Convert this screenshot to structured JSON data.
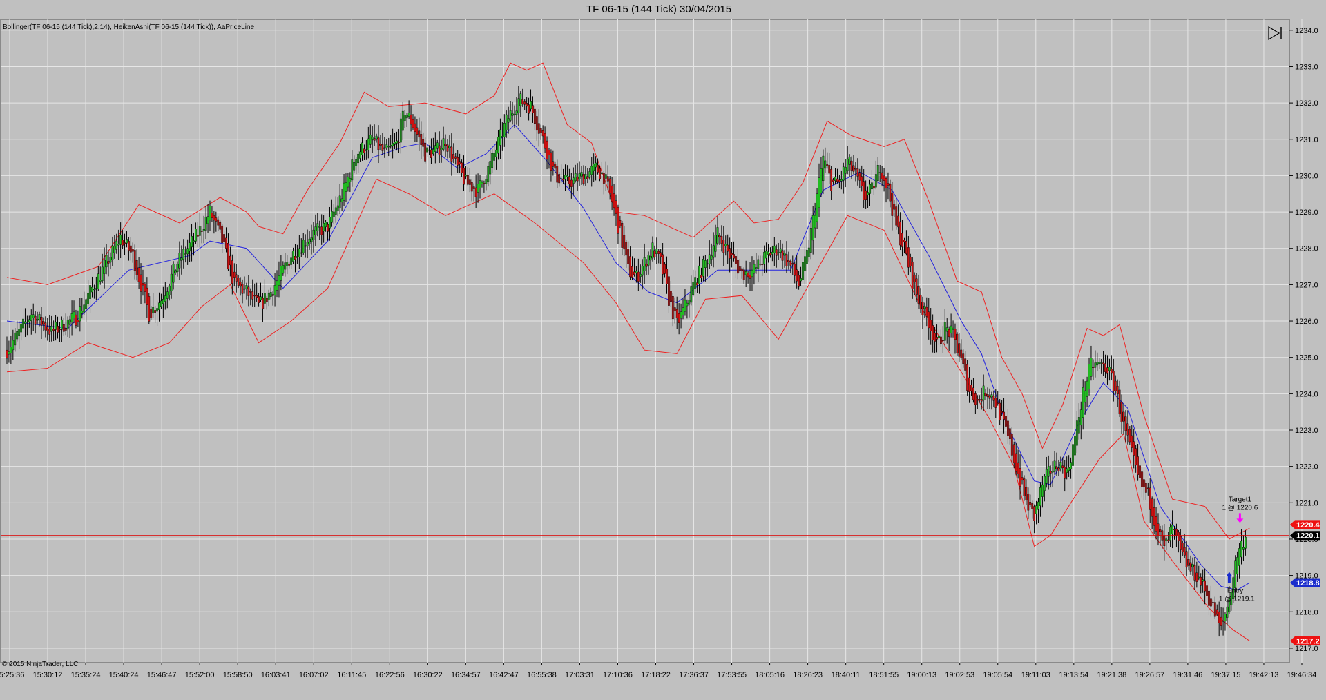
{
  "window": {
    "title": "TF 06-15 (144 Tick)  30/04/2015"
  },
  "indicator_label": "Bollinger(TF 06-15 (144 Tick),2,14), HeikenAshi(TF 06-15 (144 Tick)), AaPriceLine",
  "copyright": "© 2015 NinjaTrader, LLC",
  "icons": {
    "scroll_to_end": "play-to-end-icon",
    "target_marker": "down-arrow-icon",
    "entry_marker": "up-arrow-icon"
  },
  "colors": {
    "background": "#c0c0c0",
    "grid": "#e6e6e6",
    "candle_up": "#22bb22",
    "candle_down": "#cc1111",
    "bollinger_bands": "#ee2222",
    "bollinger_mid": "#2222dd",
    "price_line": "#dd0000",
    "target_marker": "#ff00ff",
    "entry_marker": "#1a2ccc"
  },
  "orders": {
    "target": {
      "line1": "Target1",
      "line2": "1 @ 1220.6"
    },
    "entry": {
      "line1": "Entry",
      "line2": "1 @ 1219.1"
    }
  },
  "chart_data": {
    "type": "candlestick",
    "title": "TF 06-15 (144 Tick)  30/04/2015",
    "y_axis": {
      "ylim": [
        1216.6,
        1234.3
      ],
      "ticks": [
        "1217.0",
        "1218.0",
        "1219.0",
        "1220.0",
        "1221.0",
        "1222.0",
        "1223.0",
        "1224.0",
        "1225.0",
        "1226.0",
        "1227.0",
        "1228.0",
        "1229.0",
        "1230.0",
        "1231.0",
        "1232.0",
        "1233.0",
        "1234.0"
      ],
      "grid": true
    },
    "x_axis": {
      "tick_labels": [
        "15:25:36",
        "15:30:12",
        "15:35:24",
        "15:40:24",
        "15:46:47",
        "15:52:00",
        "15:58:50",
        "16:03:41",
        "16:07:02",
        "16:11:45",
        "16:22:56",
        "16:30:22",
        "16:34:57",
        "16:42:47",
        "16:55:38",
        "17:03:31",
        "17:10:36",
        "17:18:22",
        "17:36:37",
        "17:53:55",
        "18:05:16",
        "18:26:23",
        "18:40:11",
        "18:51:55",
        "19:00:13",
        "19:02:53",
        "19:05:54",
        "19:11:03",
        "19:13:54",
        "19:21:38",
        "19:26:57",
        "19:31:46",
        "19:37:15",
        "19:42:13",
        "19:46:34"
      ],
      "grid": true
    },
    "price_markers": [
      {
        "value": 1220.4,
        "label": "1220.4",
        "color": "#ee1111",
        "text_color": "#ffffff"
      },
      {
        "value": 1220.1,
        "label": "1220.1",
        "color": "#000000",
        "text_color": "#ffffff"
      },
      {
        "value": 1218.8,
        "label": "1218.8",
        "color": "#1a2ccc",
        "text_color": "#ffffff"
      },
      {
        "value": 1217.2,
        "label": "1217.2",
        "color": "#ee1111",
        "text_color": "#ffffff"
      }
    ],
    "price_line": 1220.1,
    "target_price": 1220.6,
    "entry_price": 1219.1,
    "close_path": [
      [
        0,
        1225.2
      ],
      [
        12,
        1226.2
      ],
      [
        22,
        1225.7
      ],
      [
        34,
        1226.1
      ],
      [
        46,
        1227.3
      ],
      [
        56,
        1228.3
      ],
      [
        62,
        1227.8
      ],
      [
        70,
        1226.2
      ],
      [
        76,
        1226.6
      ],
      [
        84,
        1227.6
      ],
      [
        94,
        1228.4
      ],
      [
        100,
        1229.0
      ],
      [
        106,
        1228.2
      ],
      [
        112,
        1227.0
      ],
      [
        118,
        1226.8
      ],
      [
        124,
        1226.4
      ],
      [
        130,
        1226.8
      ],
      [
        140,
        1227.8
      ],
      [
        150,
        1228.4
      ],
      [
        158,
        1228.6
      ],
      [
        166,
        1229.6
      ],
      [
        172,
        1230.6
      ],
      [
        180,
        1231.0
      ],
      [
        186,
        1230.6
      ],
      [
        192,
        1230.9
      ],
      [
        196,
        1231.8
      ],
      [
        200,
        1231.4
      ],
      [
        206,
        1230.6
      ],
      [
        212,
        1230.7
      ],
      [
        216,
        1231.0
      ],
      [
        220,
        1230.4
      ],
      [
        226,
        1229.8
      ],
      [
        232,
        1229.6
      ],
      [
        238,
        1230.3
      ],
      [
        246,
        1231.5
      ],
      [
        252,
        1232.1
      ],
      [
        258,
        1231.9
      ],
      [
        264,
        1231.0
      ],
      [
        270,
        1230.0
      ],
      [
        276,
        1229.8
      ],
      [
        284,
        1230.0
      ],
      [
        290,
        1230.2
      ],
      [
        294,
        1230.0
      ],
      [
        298,
        1229.3
      ],
      [
        302,
        1228.4
      ],
      [
        306,
        1227.4
      ],
      [
        310,
        1227.2
      ],
      [
        314,
        1227.6
      ],
      [
        318,
        1228.0
      ],
      [
        322,
        1227.6
      ],
      [
        326,
        1226.6
      ],
      [
        330,
        1225.9
      ],
      [
        334,
        1226.4
      ],
      [
        338,
        1227.0
      ],
      [
        344,
        1227.6
      ],
      [
        350,
        1228.4
      ],
      [
        356,
        1227.8
      ],
      [
        362,
        1227.3
      ],
      [
        368,
        1227.4
      ],
      [
        374,
        1227.8
      ],
      [
        380,
        1228.0
      ],
      [
        386,
        1227.5
      ],
      [
        390,
        1227.0
      ],
      [
        394,
        1227.8
      ],
      [
        398,
        1229.1
      ],
      [
        402,
        1230.5
      ],
      [
        406,
        1229.8
      ],
      [
        410,
        1229.8
      ],
      [
        414,
        1230.4
      ],
      [
        418,
        1230.0
      ],
      [
        422,
        1229.4
      ],
      [
        426,
        1229.6
      ],
      [
        430,
        1230.3
      ],
      [
        434,
        1229.6
      ],
      [
        438,
        1228.6
      ],
      [
        442,
        1228.0
      ],
      [
        446,
        1227.1
      ],
      [
        450,
        1226.4
      ],
      [
        454,
        1226.0
      ],
      [
        458,
        1225.3
      ],
      [
        462,
        1225.8
      ],
      [
        466,
        1225.6
      ],
      [
        470,
        1224.9
      ],
      [
        474,
        1224.1
      ],
      [
        478,
        1223.8
      ],
      [
        482,
        1224.1
      ],
      [
        486,
        1223.9
      ],
      [
        490,
        1223.3
      ],
      [
        494,
        1222.6
      ],
      [
        498,
        1221.8
      ],
      [
        502,
        1221.0
      ],
      [
        506,
        1220.6
      ],
      [
        510,
        1221.5
      ],
      [
        514,
        1221.9
      ],
      [
        518,
        1222.1
      ],
      [
        522,
        1221.8
      ],
      [
        526,
        1222.8
      ],
      [
        530,
        1224.0
      ],
      [
        534,
        1224.8
      ],
      [
        538,
        1224.8
      ],
      [
        542,
        1224.7
      ],
      [
        546,
        1224.1
      ],
      [
        550,
        1223.1
      ],
      [
        554,
        1222.3
      ],
      [
        558,
        1221.5
      ],
      [
        562,
        1221.2
      ],
      [
        566,
        1220.4
      ],
      [
        570,
        1219.7
      ],
      [
        574,
        1220.3
      ],
      [
        578,
        1219.6
      ],
      [
        582,
        1219.2
      ],
      [
        586,
        1219.0
      ],
      [
        590,
        1218.6
      ],
      [
        594,
        1218.1
      ],
      [
        598,
        1217.5
      ],
      [
        602,
        1218.4
      ],
      [
        606,
        1219.6
      ],
      [
        610,
        1220.1
      ]
    ],
    "bollinger_upper": [
      [
        0,
        1227.2
      ],
      [
        20,
        1227.0
      ],
      [
        45,
        1227.5
      ],
      [
        65,
        1229.2
      ],
      [
        85,
        1228.7
      ],
      [
        105,
        1229.4
      ],
      [
        118,
        1229.0
      ],
      [
        124,
        1228.6
      ],
      [
        136,
        1228.4
      ],
      [
        148,
        1229.6
      ],
      [
        164,
        1230.9
      ],
      [
        176,
        1232.3
      ],
      [
        188,
        1231.9
      ],
      [
        206,
        1232.0
      ],
      [
        226,
        1231.7
      ],
      [
        240,
        1232.2
      ],
      [
        248,
        1233.1
      ],
      [
        256,
        1232.9
      ],
      [
        264,
        1233.1
      ],
      [
        276,
        1231.4
      ],
      [
        288,
        1230.9
      ],
      [
        300,
        1229.0
      ],
      [
        314,
        1228.9
      ],
      [
        326,
        1228.6
      ],
      [
        338,
        1228.3
      ],
      [
        348,
        1228.8
      ],
      [
        358,
        1229.3
      ],
      [
        368,
        1228.7
      ],
      [
        380,
        1228.8
      ],
      [
        392,
        1229.8
      ],
      [
        404,
        1231.5
      ],
      [
        416,
        1231.1
      ],
      [
        432,
        1230.8
      ],
      [
        442,
        1231.0
      ],
      [
        454,
        1229.3
      ],
      [
        468,
        1227.1
      ],
      [
        480,
        1226.8
      ],
      [
        490,
        1225.0
      ],
      [
        500,
        1224.0
      ],
      [
        510,
        1222.5
      ],
      [
        520,
        1223.7
      ],
      [
        532,
        1225.8
      ],
      [
        540,
        1225.6
      ],
      [
        548,
        1225.9
      ],
      [
        560,
        1223.4
      ],
      [
        574,
        1221.1
      ],
      [
        590,
        1220.9
      ],
      [
        602,
        1220.0
      ],
      [
        612,
        1220.3
      ]
    ],
    "bollinger_mid": [
      [
        0,
        1226.0
      ],
      [
        30,
        1225.8
      ],
      [
        60,
        1227.4
      ],
      [
        90,
        1227.8
      ],
      [
        100,
        1228.2
      ],
      [
        118,
        1228.0
      ],
      [
        136,
        1226.9
      ],
      [
        158,
        1228.2
      ],
      [
        180,
        1230.5
      ],
      [
        196,
        1230.8
      ],
      [
        206,
        1230.9
      ],
      [
        222,
        1230.2
      ],
      [
        236,
        1230.6
      ],
      [
        250,
        1231.4
      ],
      [
        266,
        1230.4
      ],
      [
        284,
        1229.1
      ],
      [
        300,
        1227.6
      ],
      [
        316,
        1226.8
      ],
      [
        330,
        1226.5
      ],
      [
        350,
        1227.4
      ],
      [
        366,
        1227.4
      ],
      [
        386,
        1227.4
      ],
      [
        402,
        1229.6
      ],
      [
        420,
        1230.1
      ],
      [
        436,
        1229.6
      ],
      [
        454,
        1227.8
      ],
      [
        470,
        1226.0
      ],
      [
        480,
        1225.1
      ],
      [
        492,
        1223.2
      ],
      [
        506,
        1221.6
      ],
      [
        514,
        1221.5
      ],
      [
        528,
        1223.2
      ],
      [
        540,
        1224.3
      ],
      [
        552,
        1223.6
      ],
      [
        568,
        1220.9
      ],
      [
        588,
        1219.3
      ],
      [
        598,
        1218.7
      ],
      [
        606,
        1218.6
      ],
      [
        612,
        1218.8
      ]
    ],
    "bollinger_lower": [
      [
        0,
        1224.6
      ],
      [
        20,
        1224.7
      ],
      [
        40,
        1225.4
      ],
      [
        62,
        1225.0
      ],
      [
        80,
        1225.4
      ],
      [
        96,
        1226.4
      ],
      [
        110,
        1227.0
      ],
      [
        124,
        1225.4
      ],
      [
        140,
        1226.0
      ],
      [
        158,
        1226.9
      ],
      [
        170,
        1228.4
      ],
      [
        182,
        1229.9
      ],
      [
        198,
        1229.5
      ],
      [
        216,
        1228.9
      ],
      [
        240,
        1229.5
      ],
      [
        260,
        1228.7
      ],
      [
        284,
        1227.6
      ],
      [
        300,
        1226.5
      ],
      [
        314,
        1225.2
      ],
      [
        330,
        1225.1
      ],
      [
        344,
        1226.6
      ],
      [
        362,
        1226.7
      ],
      [
        380,
        1225.5
      ],
      [
        400,
        1227.5
      ],
      [
        414,
        1228.9
      ],
      [
        432,
        1228.5
      ],
      [
        450,
        1226.4
      ],
      [
        470,
        1224.6
      ],
      [
        484,
        1223.3
      ],
      [
        496,
        1222.0
      ],
      [
        506,
        1219.8
      ],
      [
        514,
        1220.1
      ],
      [
        524,
        1221.0
      ],
      [
        538,
        1222.2
      ],
      [
        550,
        1222.9
      ],
      [
        560,
        1220.5
      ],
      [
        574,
        1219.4
      ],
      [
        592,
        1218.1
      ],
      [
        604,
        1217.5
      ],
      [
        612,
        1217.2
      ]
    ]
  }
}
